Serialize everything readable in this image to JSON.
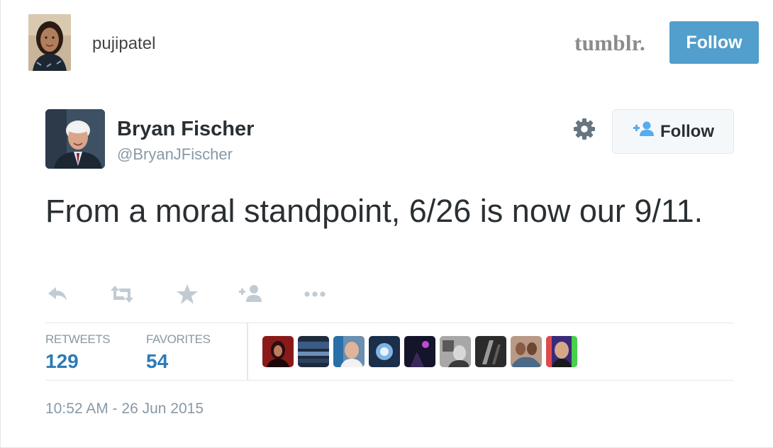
{
  "post": {
    "username": "pujipatel",
    "platform_logo": "tumblr.",
    "follow_label": "Follow",
    "brand_color": "#529ecc"
  },
  "tweet": {
    "author_name": "Bryan Fischer",
    "author_handle": "@BryanJFischer",
    "follow_label": "Follow",
    "text": "From a moral standpoint, 6/26 is now our 9/11.",
    "actions": [
      "reply-icon",
      "retweet-icon",
      "favorite-icon",
      "follow-icon",
      "more-icon"
    ],
    "stats": {
      "retweets_label": "RETWEETS",
      "retweets_count": "129",
      "favorites_label": "FAVORITES",
      "favorites_count": "54"
    },
    "favoriters_count": 9,
    "timestamp": "10:52 AM - 26 Jun 2015",
    "accent_color": "#2b7bb9",
    "muted_color": "#8899a6"
  }
}
